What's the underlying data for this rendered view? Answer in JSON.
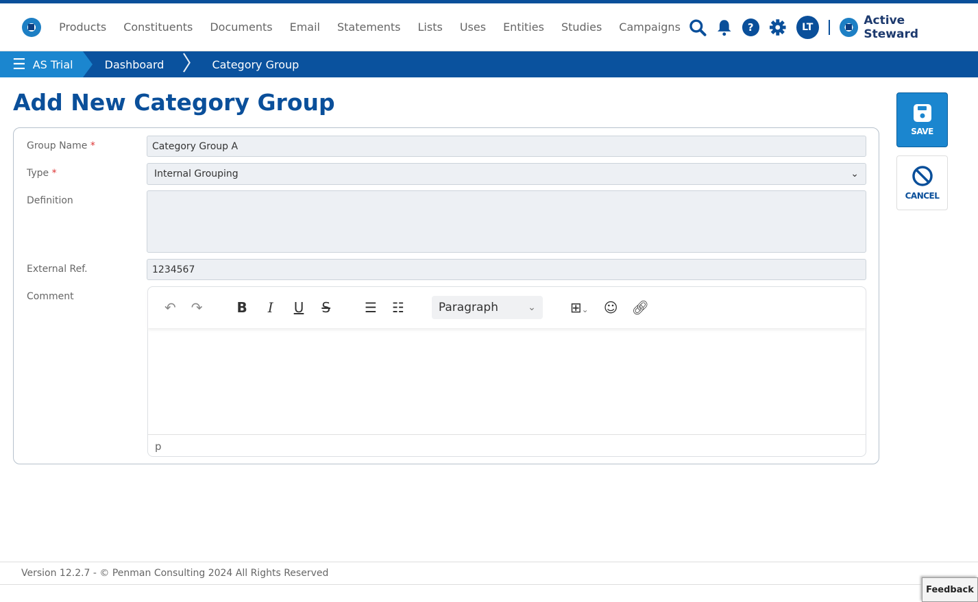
{
  "nav": {
    "items": [
      "Products",
      "Constituents",
      "Documents",
      "Email",
      "Statements",
      "Lists",
      "Uses",
      "Entities",
      "Studies",
      "Campaigns"
    ],
    "avatar": "LT",
    "brand": "Active Steward"
  },
  "breadcrumb": [
    "AS Trial",
    "Dashboard",
    "Category Group"
  ],
  "page_title": "Add New Category Group",
  "form": {
    "group_name_label": "Group Name",
    "group_name": "Category Group A",
    "type_label": "Type",
    "type": "Internal Grouping",
    "definition_label": "Definition",
    "definition": "",
    "external_ref_label": "External Ref.",
    "external_ref": "1234567",
    "comment_label": "Comment",
    "block_format": "Paragraph",
    "status_path": "p",
    "required": "*"
  },
  "actions": {
    "save": "SAVE",
    "cancel": "CANCEL"
  },
  "footer": "Version 12.2.7 - © Penman Consulting 2024 All Rights Reserved",
  "feedback": "Feedback"
}
